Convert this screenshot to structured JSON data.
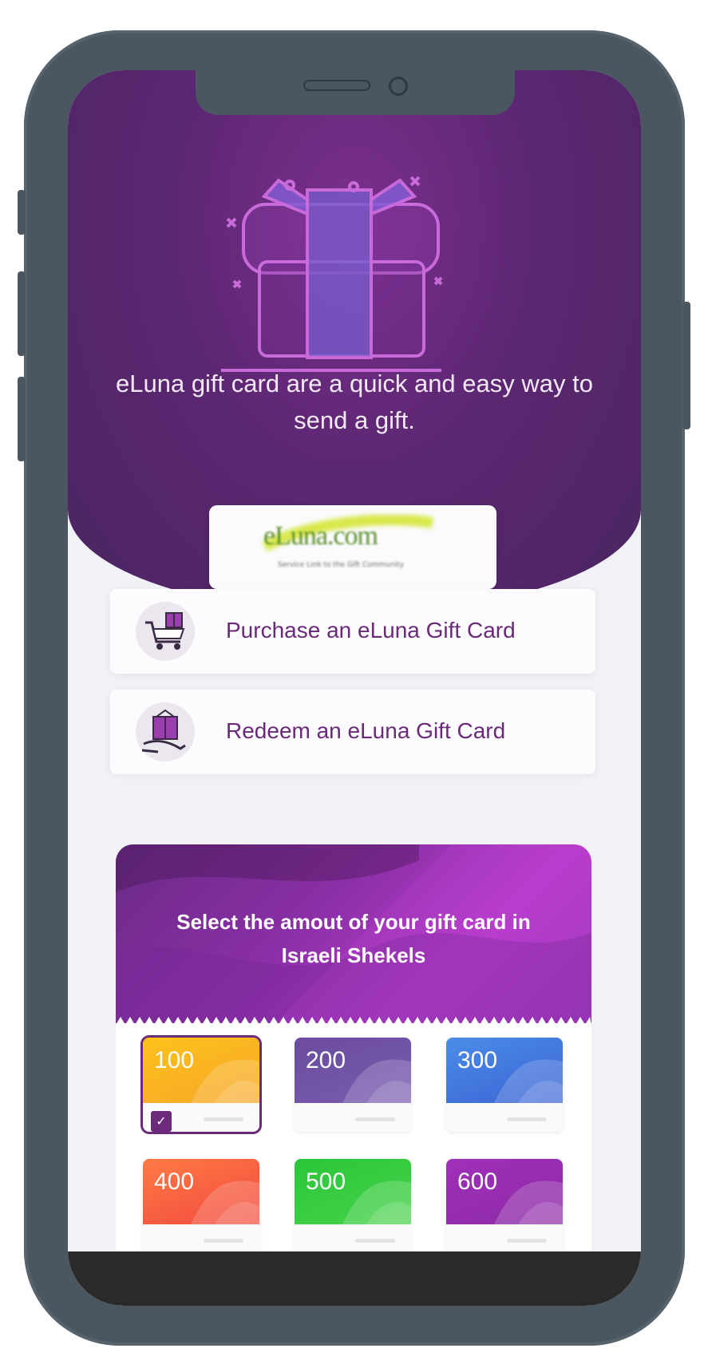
{
  "hero": {
    "text": "eLuna gift card are a quick and easy way to send a gift."
  },
  "logo": {
    "name": "eLuna.com",
    "tagline": "Service Link to the Gift Community"
  },
  "actions": [
    {
      "label": "Purchase an eLuna Gift Card",
      "icon": "cart-gift-icon"
    },
    {
      "label": "Redeem an eLuna Gift Card",
      "icon": "hand-gift-icon"
    }
  ],
  "amount": {
    "title": "Select the amout of your gift card in Israeli Shekels",
    "options": [
      {
        "value": "100",
        "color_top": "#fcc21b",
        "color_bottom": "#f8a628",
        "selected": true
      },
      {
        "value": "200",
        "color_top": "#6a4b9e",
        "color_bottom": "#7a5db0",
        "selected": false
      },
      {
        "value": "300",
        "color_top": "#4a8de8",
        "color_bottom": "#3c63d4",
        "selected": false
      },
      {
        "value": "400",
        "color_top": "#ff7a44",
        "color_bottom": "#f24a3f",
        "selected": false
      },
      {
        "value": "500",
        "color_top": "#2bc63a",
        "color_bottom": "#47d24a",
        "selected": false
      },
      {
        "value": "600",
        "color_top": "#a030b8",
        "color_bottom": "#8c2aa6",
        "selected": false
      }
    ]
  },
  "colors": {
    "accent": "#6b2a7a",
    "hero": "#5c2772",
    "device": "#4b5760"
  }
}
